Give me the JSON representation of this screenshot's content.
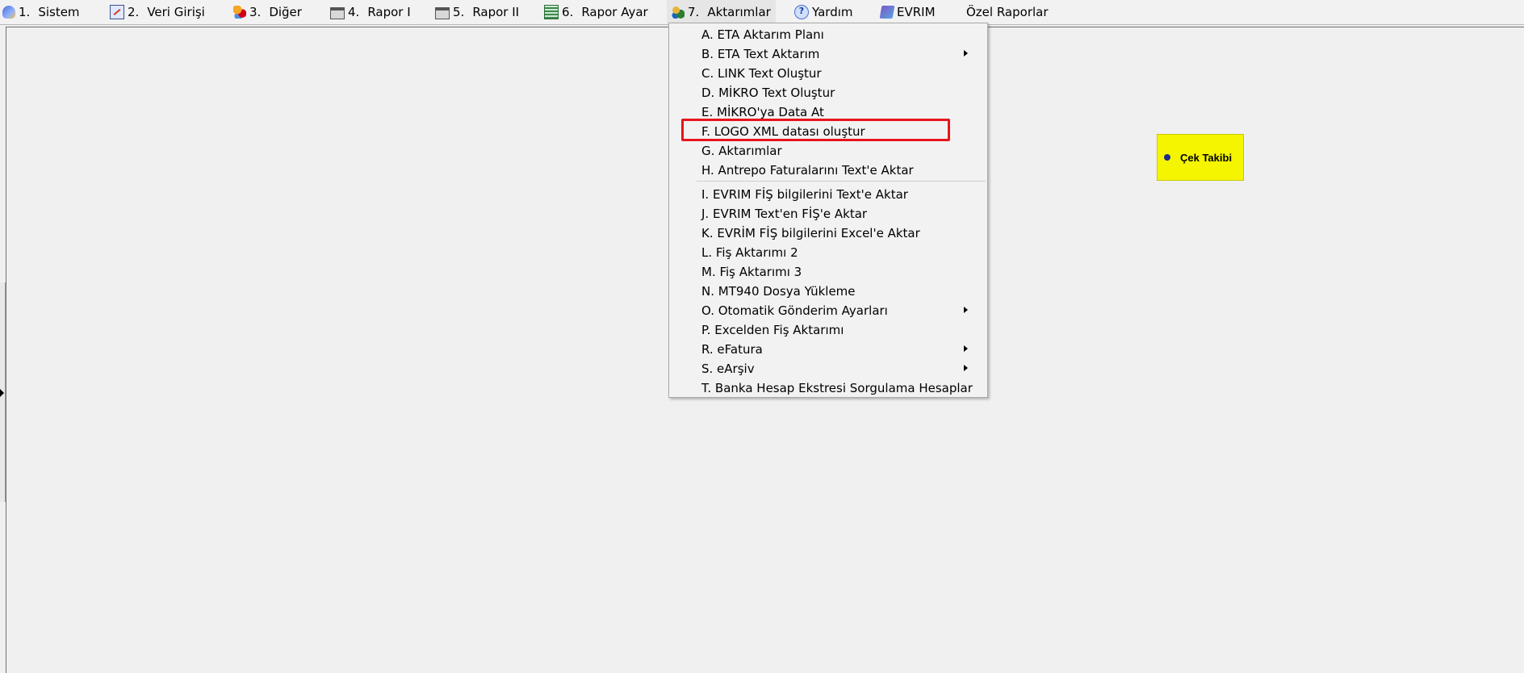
{
  "menubar": {
    "items": [
      {
        "num": "1.",
        "label": "Sistem",
        "icon": "sistem-icon"
      },
      {
        "num": "2.",
        "label": "Veri Girişi",
        "icon": "edit-icon"
      },
      {
        "num": "3.",
        "label": "Diğer",
        "icon": "shapes-icon"
      },
      {
        "num": "4.",
        "label": "Rapor I",
        "icon": "printer-icon"
      },
      {
        "num": "5.",
        "label": "Rapor II",
        "icon": "printer-icon"
      },
      {
        "num": "6.",
        "label": "Rapor Ayar",
        "icon": "report-settings-icon"
      },
      {
        "num": "7.",
        "label": "Aktarımlar",
        "icon": "transfer-icon"
      },
      {
        "label": "Yardım",
        "icon": "help-icon"
      },
      {
        "label": "EVRIM",
        "icon": "evrim-icon"
      },
      {
        "label": "Özel Raporlar"
      }
    ]
  },
  "dropdown": {
    "items": [
      {
        "label": "A.  ETA Aktarım Planı",
        "submenu": false
      },
      {
        "label": "B.  ETA Text Aktarım",
        "submenu": true
      },
      {
        "label": "C.  LINK Text Oluştur",
        "submenu": false
      },
      {
        "label": "D.  MİKRO Text Oluştur",
        "submenu": false
      },
      {
        "label": "E.  MİKRO'ya  Data  At",
        "submenu": false
      },
      {
        "label": "F.  LOGO XML datası oluştur",
        "submenu": false,
        "highlighted": true
      },
      {
        "label": "G.  Aktarımlar",
        "submenu": false
      },
      {
        "label": "H.  Antrepo Faturalarını Text'e Aktar",
        "submenu": false
      },
      {
        "label": "I.   EVRIM FİŞ bilgilerini Text'e Aktar",
        "submenu": false
      },
      {
        "label": "J.   EVRIM Text'en FİŞ'e Aktar",
        "submenu": false
      },
      {
        "label": "K.   EVRİM FİŞ bilgilerini Excel'e Aktar",
        "submenu": false
      },
      {
        "label": "L.   Fiş Aktarımı 2",
        "submenu": false
      },
      {
        "label": "M.  Fiş Aktarımı 3",
        "submenu": false
      },
      {
        "label": "N.  MT940 Dosya Yükleme",
        "submenu": false
      },
      {
        "label": "O. Otomatik Gönderim Ayarları",
        "submenu": true
      },
      {
        "label": "P.  Excelden Fiş Aktarımı",
        "submenu": false
      },
      {
        "label": "R. eFatura",
        "submenu": true
      },
      {
        "label": "S.  eArşiv",
        "submenu": true
      },
      {
        "label": "T. Banka Hesap Ekstresi Sorgulama Hesaplar",
        "submenu": false
      }
    ]
  },
  "widget": {
    "label": "Çek Takibi",
    "color": "#f5f500"
  },
  "colors": {
    "highlight": "#e8141c",
    "background": "#f0f0f0"
  }
}
